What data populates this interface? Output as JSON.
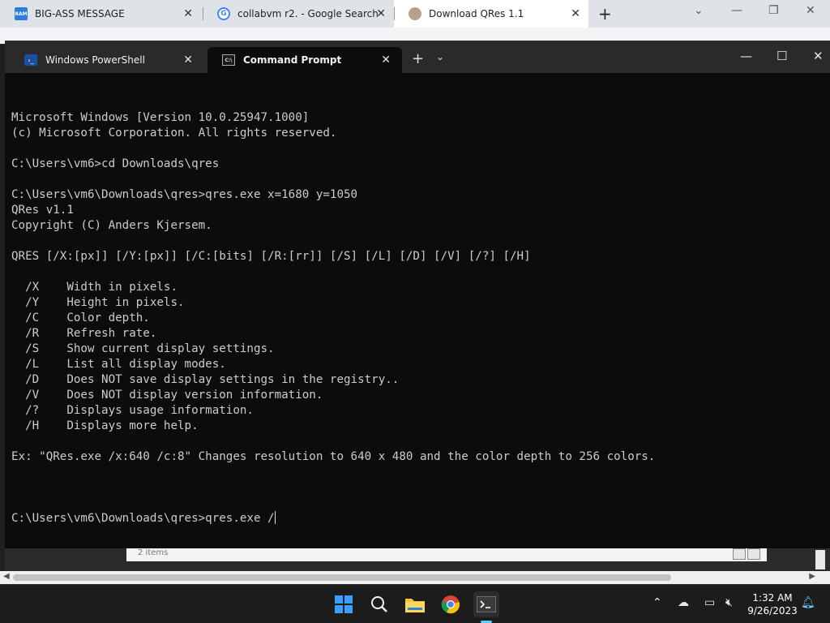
{
  "browser": {
    "tabs": [
      {
        "label": "BIG-ASS MESSAGE",
        "icon": "bam-icon",
        "favicon_text": "BAM"
      },
      {
        "label": "collabvm r2. - Google Search",
        "icon": "google-icon",
        "favicon_text": "G"
      },
      {
        "label": "Download QRes 1.1",
        "icon": "qres-site-icon"
      }
    ],
    "new_tab": "+",
    "controls": {
      "dropdown": "⌄",
      "minimize": "—",
      "restore": "❐",
      "close": "✕"
    }
  },
  "terminal": {
    "tabs": [
      {
        "label": "Windows PowerShell",
        "icon": "powershell-icon"
      },
      {
        "label": "Command Prompt",
        "icon": "cmd-icon",
        "active": true
      }
    ],
    "new_tab": "+",
    "dropdown": "⌄",
    "controls": {
      "minimize": "—",
      "maximize": "☐",
      "close": "✕"
    },
    "lines": [
      "Microsoft Windows [Version 10.0.25947.1000]",
      "(c) Microsoft Corporation. All rights reserved.",
      "",
      "C:\\Users\\vm6>cd Downloads\\qres",
      "",
      "C:\\Users\\vm6\\Downloads\\qres>qres.exe x=1680 y=1050",
      "QRes v1.1",
      "Copyright (C) Anders Kjersem.",
      "",
      "QRES [/X:[px]] [/Y:[px]] [/C:[bits] [/R:[rr]] [/S] [/L] [/D] [/V] [/?] [/H]",
      "",
      "  /X    Width in pixels.",
      "  /Y    Height in pixels.",
      "  /C    Color depth.",
      "  /R    Refresh rate.",
      "  /S    Show current display settings.",
      "  /L    List all display modes.",
      "  /D    Does NOT save display settings in the registry..",
      "  /V    Does NOT display version information.",
      "  /?    Displays usage information.",
      "  /H    Displays more help.",
      "",
      "Ex: \"QRes.exe /x:640 /c:8\" Changes resolution to 640 x 480 and the color depth to 256 colors.",
      ""
    ],
    "prompt_line": "C:\\Users\\vm6\\Downloads\\qres>qres.exe /"
  },
  "explorer": {
    "item_count": "2 items"
  },
  "taskbar": {
    "apps": [
      "start-icon",
      "search-icon",
      "file-explorer-icon",
      "chrome-icon",
      "terminal-icon"
    ],
    "time": "1:32 AM",
    "date": "9/26/2023"
  },
  "colors": {
    "console_bg": "#0c0c0c",
    "console_text": "#cccccc",
    "titlebar_bg": "#2a2a2a",
    "taskbar_bg": "#1c1c1c",
    "accent": "#60cdff"
  }
}
